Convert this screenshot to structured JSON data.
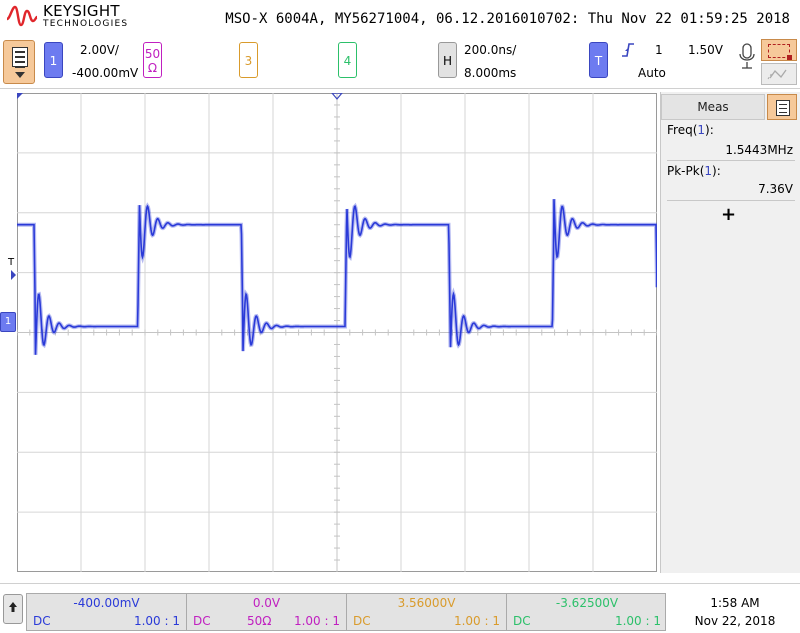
{
  "header": {
    "brand": "KEYSIGHT",
    "brand_sub": "TECHNOLOGIES",
    "instrument_line": "MSO-X 6004A, MY56271004, 06.12.2016010702: Thu Nov 22 01:59:25 2018"
  },
  "channel1": {
    "button": "1",
    "scale": "2.00V/",
    "offset": "-400.00mV"
  },
  "channel2": {
    "button_top": "50",
    "button_bottom": "Ω"
  },
  "channel3": {
    "button": "3"
  },
  "channel4": {
    "button": "4"
  },
  "horizontal": {
    "button": "H",
    "time_per_div": "200.0ns/",
    "delay": "8.000ms"
  },
  "trigger": {
    "button": "T",
    "source": "1",
    "level": "1.50V",
    "mode": "Auto"
  },
  "markers": {
    "ch1_ground": "1",
    "trigger_level": "T"
  },
  "measurements": {
    "tab_label": "Meas",
    "items": [
      {
        "name": "Freq",
        "channel": "1",
        "value": "1.5443MHz"
      },
      {
        "name": "Pk-Pk",
        "channel": "1",
        "value": "7.36V"
      }
    ],
    "add_label": "+"
  },
  "bottom": {
    "channels": [
      {
        "offset": "-400.00mV",
        "coupling": "DC",
        "impedance": "",
        "probe": "1.00 : 1"
      },
      {
        "offset": "0.0V",
        "coupling": "DC",
        "impedance": "50Ω",
        "probe": "1.00 : 1"
      },
      {
        "offset": "3.56000V",
        "coupling": "DC",
        "impedance": "",
        "probe": "1.00 : 1"
      },
      {
        "offset": "-3.62500V",
        "coupling": "DC",
        "impedance": "",
        "probe": "1.00 : 1"
      }
    ],
    "time": "1:58 AM",
    "date": "Nov 22, 2018"
  },
  "colors": {
    "ch1": "#2a3ad8",
    "ch2": "#c020c0",
    "ch3": "#d99b2c",
    "ch4": "#2cc06a",
    "accent_orange": "#f6c99a"
  },
  "waveform": {
    "channel": "1",
    "shape": "square wave with ringing",
    "high_level_div": -1.8,
    "low_level_div": -0.1,
    "period_div": 3.24
  }
}
